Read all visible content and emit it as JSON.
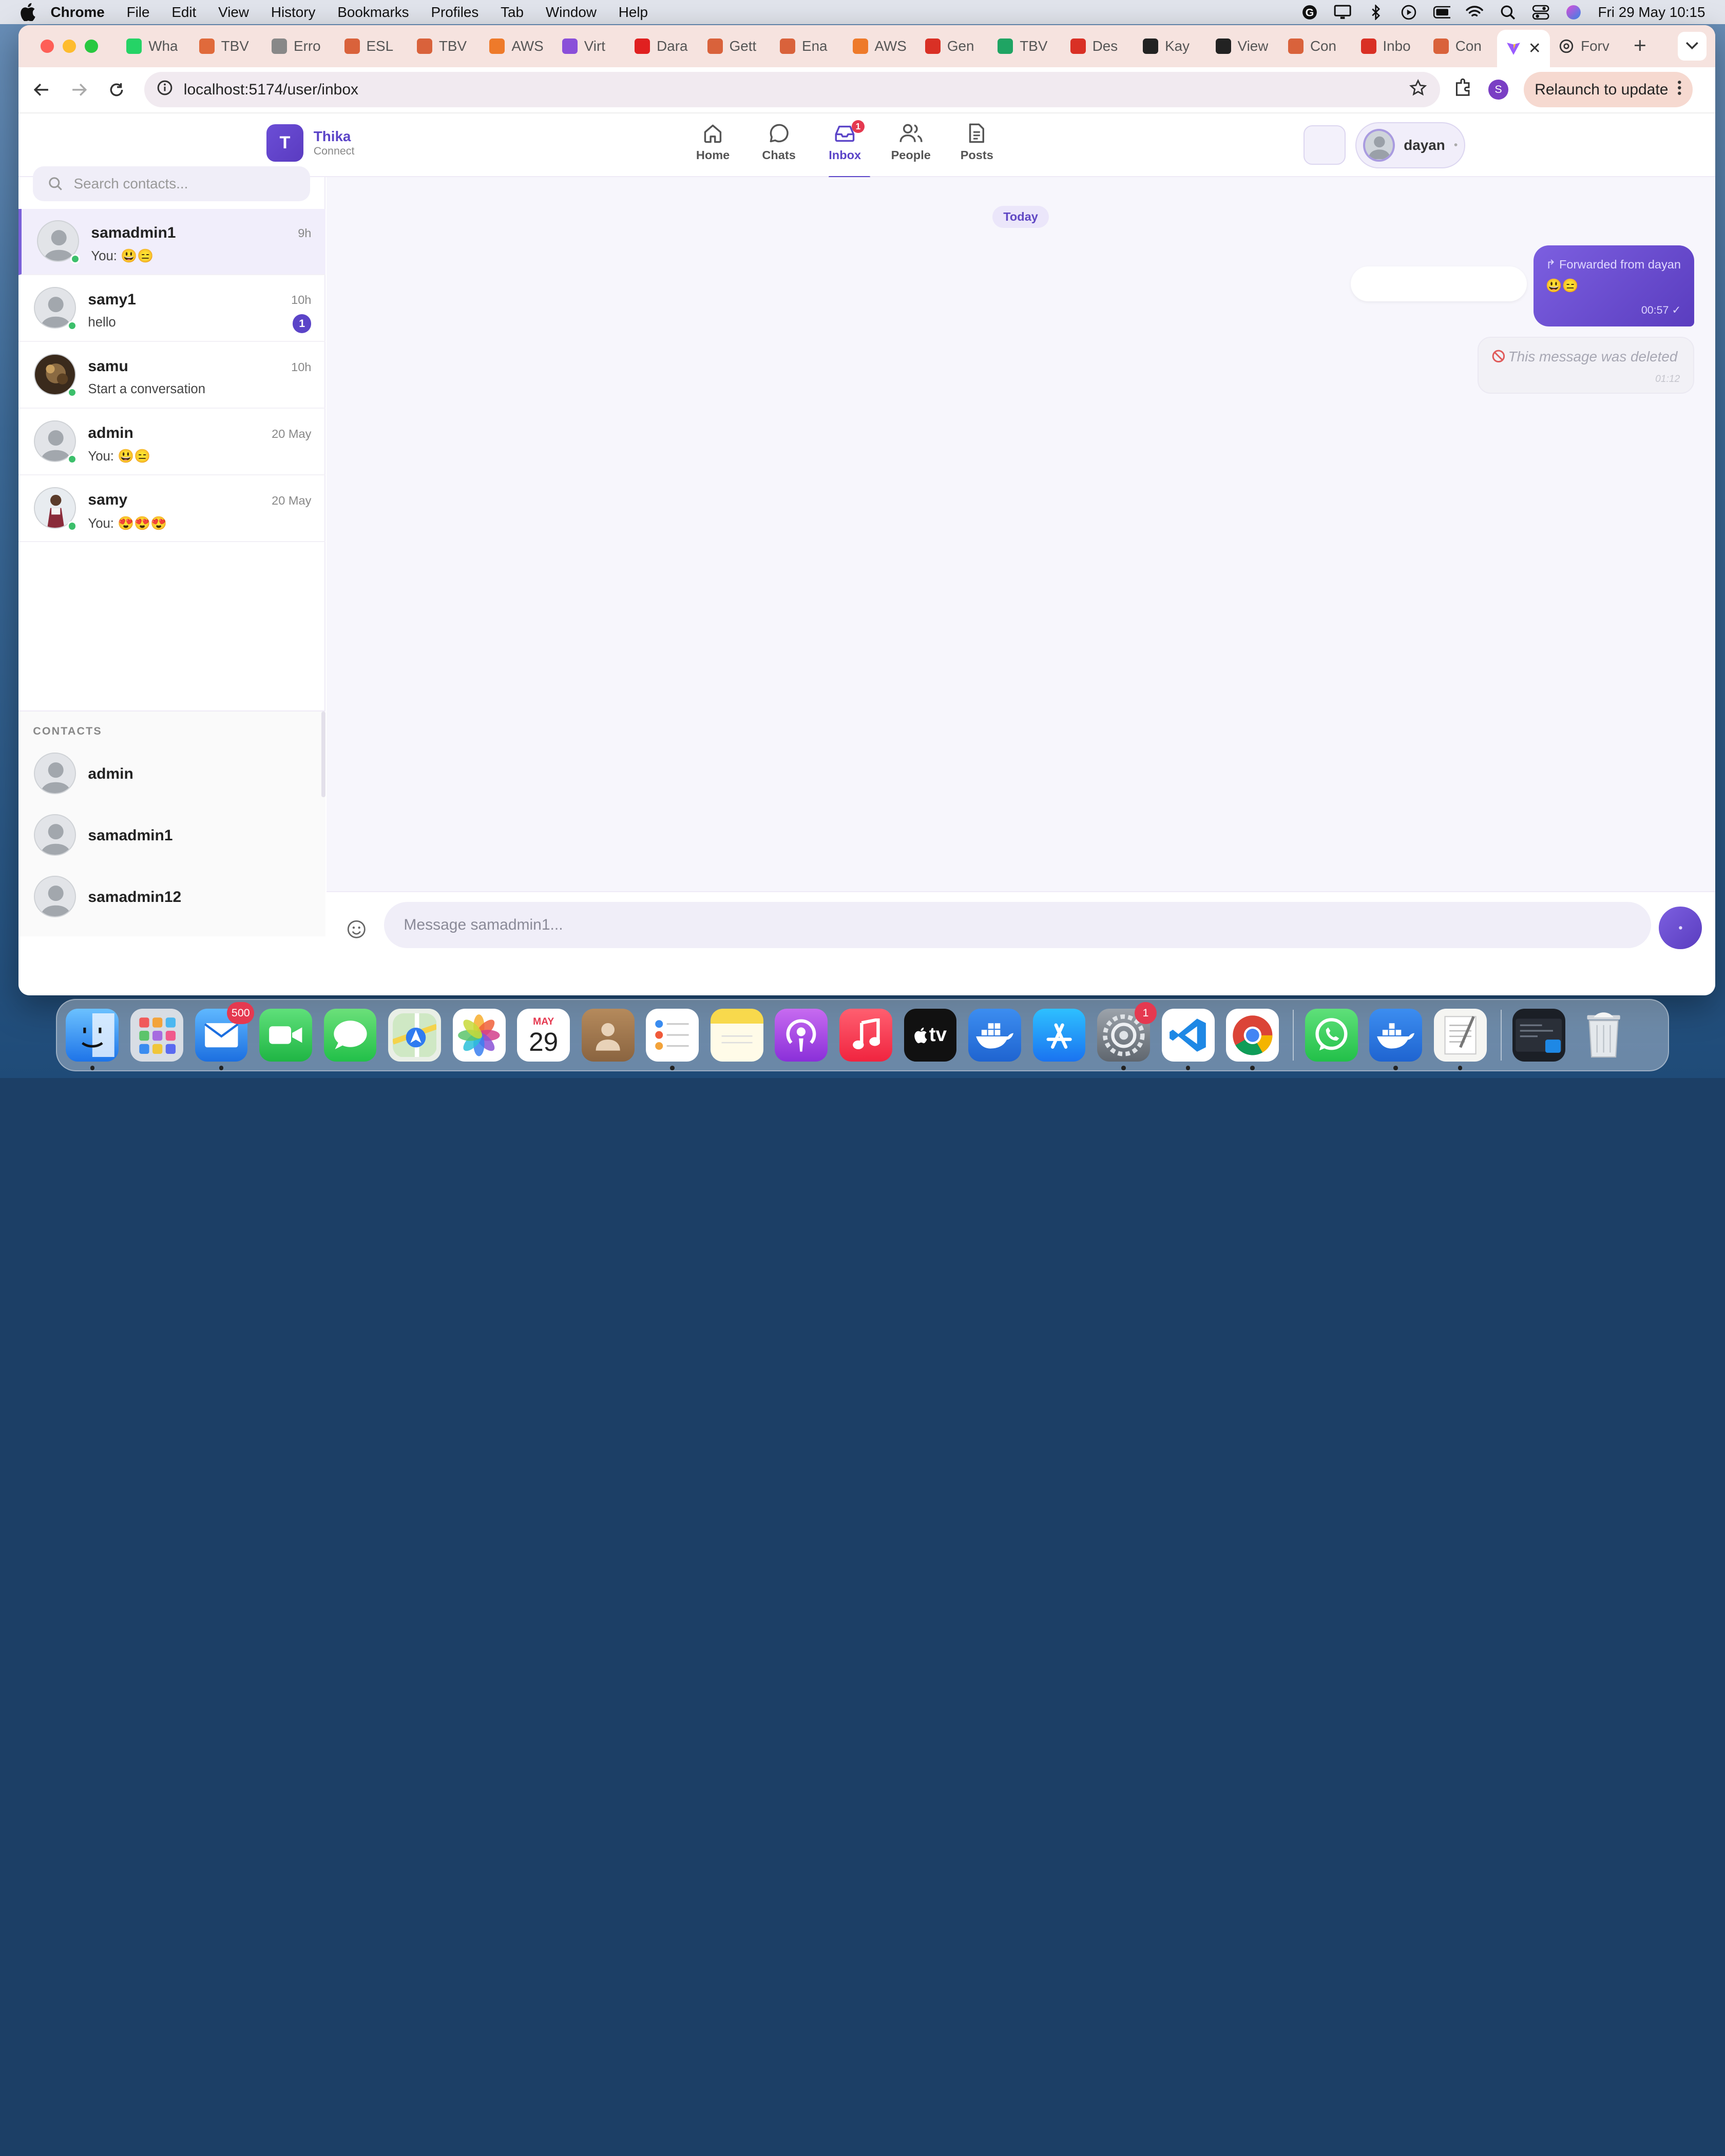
{
  "menubar": {
    "app": "Chrome",
    "items": [
      "File",
      "Edit",
      "View",
      "History",
      "Bookmarks",
      "Profiles",
      "Tab",
      "Window",
      "Help"
    ],
    "clock": "Fri 29 May  10:15"
  },
  "browser": {
    "tabs": [
      {
        "label": "Wha",
        "color": "#25d366"
      },
      {
        "label": "TBV",
        "color": "#e06a3b"
      },
      {
        "label": "Erro",
        "color": "#888888"
      },
      {
        "label": "ESL",
        "color": "#d9623b"
      },
      {
        "label": "TBV",
        "color": "#d9623b"
      },
      {
        "label": "AWS",
        "color": "#ee7a2a"
      },
      {
        "label": "Virt",
        "color": "#8a4fd9"
      },
      {
        "label": "Dara",
        "color": "#e02020"
      },
      {
        "label": "Gett",
        "color": "#d9623b"
      },
      {
        "label": "Ena",
        "color": "#d9623b"
      },
      {
        "label": "AWS",
        "color": "#ee7a2a"
      },
      {
        "label": "Gen",
        "color": "#d93025"
      },
      {
        "label": "TBV",
        "color": "#1fa463"
      },
      {
        "label": "Des",
        "color": "#d93025"
      },
      {
        "label": "Kay",
        "color": "#222222"
      },
      {
        "label": "View",
        "color": "#222222"
      },
      {
        "label": "Con",
        "color": "#d9623b"
      },
      {
        "label": "Inbo",
        "color": "#d93025"
      },
      {
        "label": "Con",
        "color": "#d9623b"
      }
    ],
    "active_tab_close": "✕",
    "last_tab": {
      "label": "Forv"
    },
    "url": "localhost:5174/user/inbox",
    "profile_initial": "S",
    "relaunch": "Relaunch to update"
  },
  "app": {
    "logo_letter": "T",
    "logo_title": "Thika",
    "logo_sub": "Connect",
    "nav": [
      {
        "label": "Home"
      },
      {
        "label": "Chats"
      },
      {
        "label": "Inbox",
        "badge": "1"
      },
      {
        "label": "People"
      },
      {
        "label": "Posts"
      }
    ],
    "user": {
      "name": "dayan",
      "caret": "•"
    }
  },
  "sidebar": {
    "search_placeholder": "Search contacts...",
    "conversations": [
      {
        "name": "samadmin1",
        "preview": "You: 😃😑",
        "time": "9h",
        "online": true
      },
      {
        "name": "samy1",
        "preview": "hello",
        "time": "10h",
        "badge": "1",
        "online": true
      },
      {
        "name": "samu",
        "preview": "Start a conversation",
        "time": "10h",
        "online": true
      },
      {
        "name": "admin",
        "preview": "You: 😃😑",
        "time": "20 May",
        "online": true
      },
      {
        "name": "samy",
        "preview": "You: 😍😍😍",
        "time": "20 May",
        "online": true
      }
    ],
    "contacts_heading": "CONTACTS",
    "contacts": [
      {
        "name": "admin"
      },
      {
        "name": "samadmin1"
      },
      {
        "name": "samadmin12"
      }
    ]
  },
  "chat": {
    "date_divider": "Today",
    "forwarded_label": "↱ Forwarded from dayan",
    "forwarded_body": "😃😑",
    "forwarded_time": "00:57 ✓",
    "deleted_text": "This message was deleted",
    "deleted_time": "01:12",
    "composer_placeholder": "Message samadmin1..."
  },
  "dock": {
    "mail_badge": "500",
    "calendar_month": "MAY",
    "calendar_day": "29",
    "tv_label": "tv",
    "settings_badge": "1"
  },
  "colors": {
    "accent": "#5b44c8",
    "online": "#3cbf6b",
    "badge": "#e53950"
  }
}
